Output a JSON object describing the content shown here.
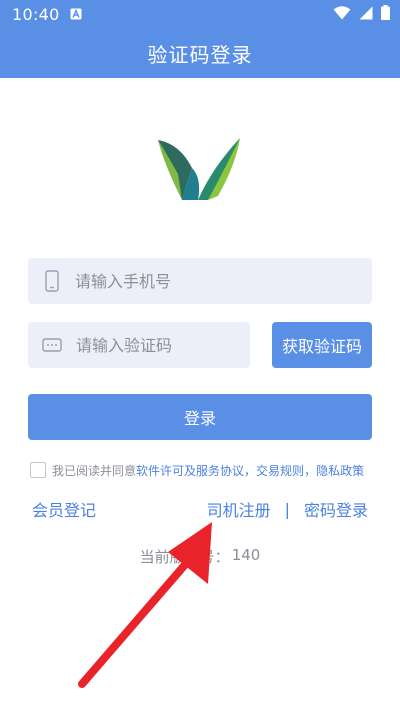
{
  "status_bar": {
    "time": "10:40",
    "icons": [
      "notification-a-icon",
      "wifi-icon",
      "signal-icon",
      "battery-icon"
    ]
  },
  "header": {
    "title": "验证码登录"
  },
  "form": {
    "phone_placeholder": "请输入手机号",
    "code_placeholder": "请输入验证码",
    "get_code_label": "获取验证码",
    "login_label": "登录"
  },
  "agreement": {
    "prefix": "我已阅读并同意",
    "links": [
      "软件许可及服务协议",
      "交易规则",
      "隐私政策"
    ],
    "separators": [
      "，",
      "，"
    ]
  },
  "links": {
    "member_register": "会员登记",
    "driver_register": "司机注册",
    "separator": "|",
    "password_login": "密码登录"
  },
  "version": {
    "label": "当前版本号：",
    "value": "140"
  },
  "colors": {
    "primary": "#5a8fe6",
    "link": "#4c82e2",
    "field_bg": "#eceff7",
    "annotation_arrow": "#e8232a"
  }
}
